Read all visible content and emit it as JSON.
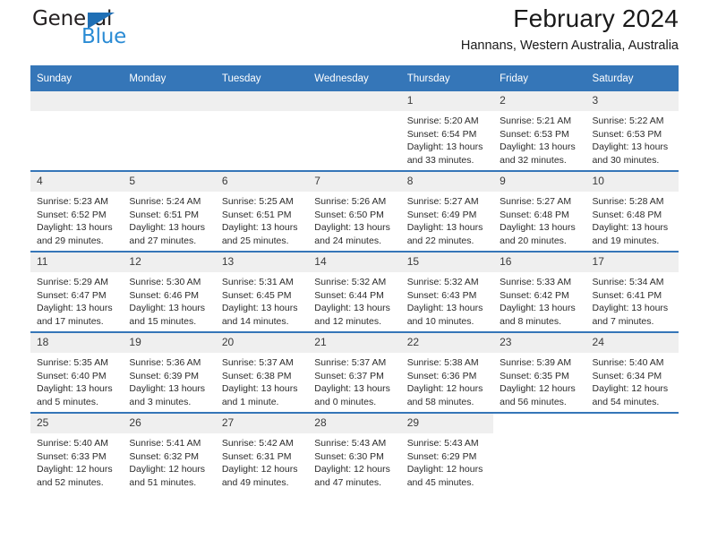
{
  "logo": {
    "word_one": "General",
    "word_two": "Blue",
    "triangle_color": "#1f6fb5",
    "word_two_color": "#2a8bd4"
  },
  "header": {
    "title": "February 2024",
    "location": "Hannans, Western Australia, Australia"
  },
  "theme": {
    "header_blue": "#3576b8",
    "daynum_band": "#efefef",
    "text": "#2b2b2b"
  },
  "calendar": {
    "weekday_headers": [
      "Sunday",
      "Monday",
      "Tuesday",
      "Wednesday",
      "Thursday",
      "Friday",
      "Saturday"
    ],
    "weeks": [
      [
        {
          "day": "",
          "blank": true
        },
        {
          "day": "",
          "blank": true
        },
        {
          "day": "",
          "blank": true
        },
        {
          "day": "",
          "blank": true
        },
        {
          "day": "1",
          "sunrise": "Sunrise: 5:20 AM",
          "sunset": "Sunset: 6:54 PM",
          "daylight_line1": "Daylight: 13 hours",
          "daylight_line2": "and 33 minutes."
        },
        {
          "day": "2",
          "sunrise": "Sunrise: 5:21 AM",
          "sunset": "Sunset: 6:53 PM",
          "daylight_line1": "Daylight: 13 hours",
          "daylight_line2": "and 32 minutes."
        },
        {
          "day": "3",
          "sunrise": "Sunrise: 5:22 AM",
          "sunset": "Sunset: 6:53 PM",
          "daylight_line1": "Daylight: 13 hours",
          "daylight_line2": "and 30 minutes."
        }
      ],
      [
        {
          "day": "4",
          "sunrise": "Sunrise: 5:23 AM",
          "sunset": "Sunset: 6:52 PM",
          "daylight_line1": "Daylight: 13 hours",
          "daylight_line2": "and 29 minutes."
        },
        {
          "day": "5",
          "sunrise": "Sunrise: 5:24 AM",
          "sunset": "Sunset: 6:51 PM",
          "daylight_line1": "Daylight: 13 hours",
          "daylight_line2": "and 27 minutes."
        },
        {
          "day": "6",
          "sunrise": "Sunrise: 5:25 AM",
          "sunset": "Sunset: 6:51 PM",
          "daylight_line1": "Daylight: 13 hours",
          "daylight_line2": "and 25 minutes."
        },
        {
          "day": "7",
          "sunrise": "Sunrise: 5:26 AM",
          "sunset": "Sunset: 6:50 PM",
          "daylight_line1": "Daylight: 13 hours",
          "daylight_line2": "and 24 minutes."
        },
        {
          "day": "8",
          "sunrise": "Sunrise: 5:27 AM",
          "sunset": "Sunset: 6:49 PM",
          "daylight_line1": "Daylight: 13 hours",
          "daylight_line2": "and 22 minutes."
        },
        {
          "day": "9",
          "sunrise": "Sunrise: 5:27 AM",
          "sunset": "Sunset: 6:48 PM",
          "daylight_line1": "Daylight: 13 hours",
          "daylight_line2": "and 20 minutes."
        },
        {
          "day": "10",
          "sunrise": "Sunrise: 5:28 AM",
          "sunset": "Sunset: 6:48 PM",
          "daylight_line1": "Daylight: 13 hours",
          "daylight_line2": "and 19 minutes."
        }
      ],
      [
        {
          "day": "11",
          "sunrise": "Sunrise: 5:29 AM",
          "sunset": "Sunset: 6:47 PM",
          "daylight_line1": "Daylight: 13 hours",
          "daylight_line2": "and 17 minutes."
        },
        {
          "day": "12",
          "sunrise": "Sunrise: 5:30 AM",
          "sunset": "Sunset: 6:46 PM",
          "daylight_line1": "Daylight: 13 hours",
          "daylight_line2": "and 15 minutes."
        },
        {
          "day": "13",
          "sunrise": "Sunrise: 5:31 AM",
          "sunset": "Sunset: 6:45 PM",
          "daylight_line1": "Daylight: 13 hours",
          "daylight_line2": "and 14 minutes."
        },
        {
          "day": "14",
          "sunrise": "Sunrise: 5:32 AM",
          "sunset": "Sunset: 6:44 PM",
          "daylight_line1": "Daylight: 13 hours",
          "daylight_line2": "and 12 minutes."
        },
        {
          "day": "15",
          "sunrise": "Sunrise: 5:32 AM",
          "sunset": "Sunset: 6:43 PM",
          "daylight_line1": "Daylight: 13 hours",
          "daylight_line2": "and 10 minutes."
        },
        {
          "day": "16",
          "sunrise": "Sunrise: 5:33 AM",
          "sunset": "Sunset: 6:42 PM",
          "daylight_line1": "Daylight: 13 hours",
          "daylight_line2": "and 8 minutes."
        },
        {
          "day": "17",
          "sunrise": "Sunrise: 5:34 AM",
          "sunset": "Sunset: 6:41 PM",
          "daylight_line1": "Daylight: 13 hours",
          "daylight_line2": "and 7 minutes."
        }
      ],
      [
        {
          "day": "18",
          "sunrise": "Sunrise: 5:35 AM",
          "sunset": "Sunset: 6:40 PM",
          "daylight_line1": "Daylight: 13 hours",
          "daylight_line2": "and 5 minutes."
        },
        {
          "day": "19",
          "sunrise": "Sunrise: 5:36 AM",
          "sunset": "Sunset: 6:39 PM",
          "daylight_line1": "Daylight: 13 hours",
          "daylight_line2": "and 3 minutes."
        },
        {
          "day": "20",
          "sunrise": "Sunrise: 5:37 AM",
          "sunset": "Sunset: 6:38 PM",
          "daylight_line1": "Daylight: 13 hours",
          "daylight_line2": "and 1 minute."
        },
        {
          "day": "21",
          "sunrise": "Sunrise: 5:37 AM",
          "sunset": "Sunset: 6:37 PM",
          "daylight_line1": "Daylight: 13 hours",
          "daylight_line2": "and 0 minutes."
        },
        {
          "day": "22",
          "sunrise": "Sunrise: 5:38 AM",
          "sunset": "Sunset: 6:36 PM",
          "daylight_line1": "Daylight: 12 hours",
          "daylight_line2": "and 58 minutes."
        },
        {
          "day": "23",
          "sunrise": "Sunrise: 5:39 AM",
          "sunset": "Sunset: 6:35 PM",
          "daylight_line1": "Daylight: 12 hours",
          "daylight_line2": "and 56 minutes."
        },
        {
          "day": "24",
          "sunrise": "Sunrise: 5:40 AM",
          "sunset": "Sunset: 6:34 PM",
          "daylight_line1": "Daylight: 12 hours",
          "daylight_line2": "and 54 minutes."
        }
      ],
      [
        {
          "day": "25",
          "sunrise": "Sunrise: 5:40 AM",
          "sunset": "Sunset: 6:33 PM",
          "daylight_line1": "Daylight: 12 hours",
          "daylight_line2": "and 52 minutes."
        },
        {
          "day": "26",
          "sunrise": "Sunrise: 5:41 AM",
          "sunset": "Sunset: 6:32 PM",
          "daylight_line1": "Daylight: 12 hours",
          "daylight_line2": "and 51 minutes."
        },
        {
          "day": "27",
          "sunrise": "Sunrise: 5:42 AM",
          "sunset": "Sunset: 6:31 PM",
          "daylight_line1": "Daylight: 12 hours",
          "daylight_line2": "and 49 minutes."
        },
        {
          "day": "28",
          "sunrise": "Sunrise: 5:43 AM",
          "sunset": "Sunset: 6:30 PM",
          "daylight_line1": "Daylight: 12 hours",
          "daylight_line2": "and 47 minutes."
        },
        {
          "day": "29",
          "sunrise": "Sunrise: 5:43 AM",
          "sunset": "Sunset: 6:29 PM",
          "daylight_line1": "Daylight: 12 hours",
          "daylight_line2": "and 45 minutes."
        },
        {
          "day": "",
          "blank": true
        },
        {
          "day": "",
          "blank": true
        }
      ]
    ]
  }
}
